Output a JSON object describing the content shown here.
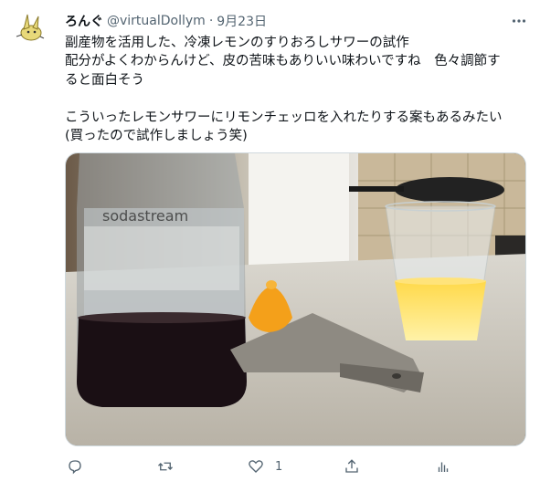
{
  "tweet": {
    "display_name": "ろんぐ",
    "handle": "@virtualDollym",
    "separator": "·",
    "date": "9月23日",
    "text_lines": [
      "副産物を活用した、冷凍レモンのすりおろしサワーの試作",
      "配分がよくわからんけど、皮の苦味もありいい味わいですね　色々調節す",
      "ると面白そう",
      "",
      "こういったレモンサワーにリモンチェッロを入れたりする案もあるみたい",
      "(買ったので試作しましょう笑)"
    ],
    "media_text": "sodastream",
    "actions": {
      "reply_icon": "reply-icon",
      "retweet_icon": "retweet-icon",
      "like_icon": "heart-icon",
      "like_count": "1",
      "share_icon": "share-icon",
      "analytics_icon": "analytics-icon"
    }
  },
  "colors": {
    "text_primary": "#0f1419",
    "text_secondary": "#536471",
    "border": "#cfd9de"
  }
}
